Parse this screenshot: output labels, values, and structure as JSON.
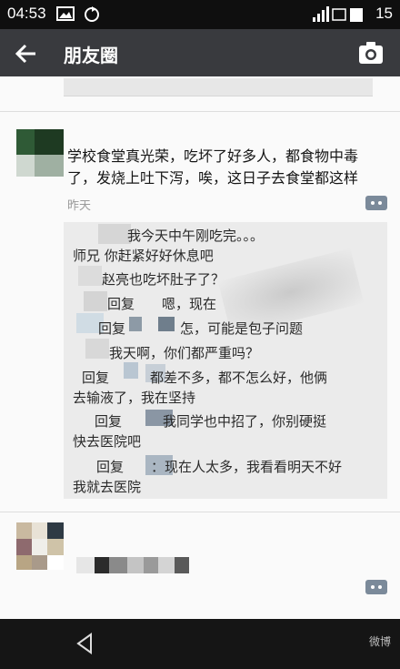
{
  "status_bar": {
    "time": "04:53",
    "battery": "15"
  },
  "title_bar": {
    "title": "朋友圈"
  },
  "post": {
    "text": "学校食堂真光荣，吃坏了好多人，都食物中毒了，发烧上吐下泻，唉，这日子去食堂都这样",
    "time": "昨天"
  },
  "comments": [
    {
      "text": "我今天中午刚吃完。。。"
    },
    {
      "text": "师兄 你赶紧好好休息吧"
    },
    {
      "text": "赵亮也吃坏肚子了？"
    },
    {
      "text": "回复　　嗯，现在"
    },
    {
      "text": "回复　　　　怎，可能是包子问题"
    },
    {
      "text": "我天啊，你们都严重吗？"
    },
    {
      "text": "回复　　　都差不多，都不怎么好，他俩"
    },
    {
      "text": "去输液了，我在坚持"
    },
    {
      "text": "回复　　　我同学也中招了，你别硬挺"
    },
    {
      "text": "快去医院吧"
    },
    {
      "text": "回复　　：现在人太多，我看看明天不好"
    },
    {
      "text": "我就去医院"
    }
  ],
  "footer": {
    "watermark": "微博"
  },
  "icons": {
    "picture": "picture-icon",
    "sync": "sync-icon",
    "signal": "signal-icon",
    "back": "back-arrow-icon",
    "camera": "camera-icon",
    "more": "more-icon",
    "nav_back": "nav-back-icon"
  }
}
